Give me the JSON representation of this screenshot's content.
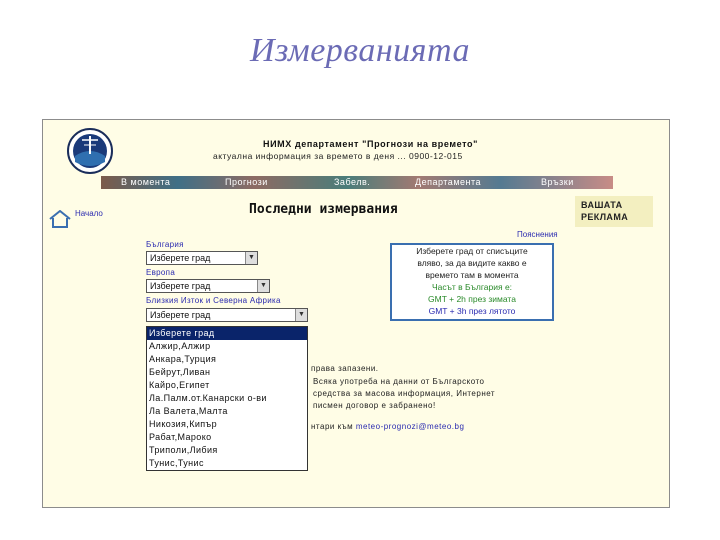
{
  "slide_title": "Измерванията",
  "header": {
    "org": "НИМХ  департамент \"Прогнози на времето\"",
    "subtitle": "актуална информация за времето в деня  ... 0900-12-015"
  },
  "nav": [
    "В момента",
    "Прогнози",
    "Забелв.",
    "Департамента",
    "Връзки"
  ],
  "home_label": "Начало",
  "page_heading": "Последни измервания",
  "ad": {
    "line1": "ВАШАТА",
    "line2": "РЕКЛАМА"
  },
  "help_link": "Пояснения",
  "info_box": {
    "line1": "Изберете град от списъците",
    "line2": "вляво, за да видите какво е",
    "line3": "времето там в момента",
    "line4": "Часът в България е:",
    "line5": "GMT + 2h през зимата",
    "line6": "GMT + 3h през лятото"
  },
  "selects": [
    {
      "label": "България",
      "value": "Изберете град"
    },
    {
      "label": "Европа",
      "value": "Изберете град"
    },
    {
      "label": "Близкия Изток и Северна Африка",
      "value": "Изберете град"
    }
  ],
  "dropdown_options": [
    "Изберете град",
    "Алжир,Алжир",
    "Анкара,Турция",
    "Бейрут,Ливан",
    "Кайро,Египет",
    "Ла.Палм.от.Канарски о-ви",
    "Ла Валета,Малта",
    "Никозия,Кипър",
    "Рабат,Мароко",
    "Триполи,Либия",
    "Тунис,Тунис"
  ],
  "footer": {
    "line1": "права запазени.",
    "line2": "Всяка употреба на данни от Българското",
    "line3": "средства за масова информация, Интернет",
    "line4": "писмен договор е забранено!",
    "line5_prefix": "нтари към",
    "email": "meteo-prognozi@meteo.bg"
  },
  "colors": {
    "title": "#6b6bb5",
    "panel_bg": "#fffde6",
    "selected": "#0a246a",
    "link": "#2b2bb0"
  }
}
